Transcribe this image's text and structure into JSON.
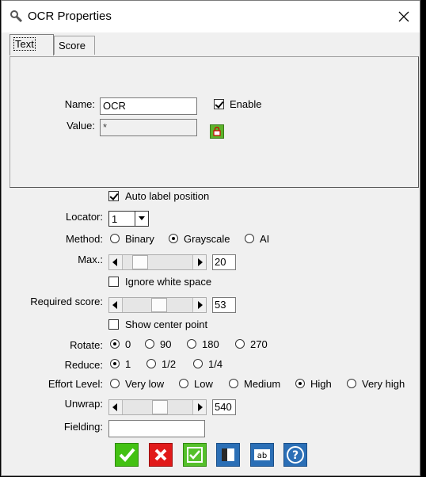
{
  "window": {
    "title": "OCR Properties"
  },
  "tabs": [
    "Text",
    "Score"
  ],
  "panel": {
    "name_label": "Name:",
    "name_value": "OCR",
    "enable_label": "Enable",
    "value_label": "Value:",
    "value_value": "*"
  },
  "auto_label": "Auto label position",
  "locator": {
    "label": "Locator:",
    "value": "1"
  },
  "method": {
    "label": "Method:",
    "options": [
      "Binary",
      "Grayscale",
      "AI"
    ],
    "selected": "Grayscale"
  },
  "max": {
    "label": "Max.:",
    "value": "20",
    "level": 0.17
  },
  "ignore_ws": "Ignore white space",
  "required_score": {
    "label": "Required score:",
    "value": "53",
    "level": 0.53
  },
  "show_center": "Show center point",
  "rotate": {
    "label": "Rotate:",
    "options": [
      "0",
      "90",
      "180",
      "270"
    ],
    "selected": "0"
  },
  "reduce": {
    "label": "Reduce:",
    "options": [
      "1",
      "1/2",
      "1/4"
    ],
    "selected": "1"
  },
  "effort": {
    "label": "Effort Level:",
    "options": [
      "Very low",
      "Low",
      "Medium",
      "High",
      "Very high"
    ],
    "selected": "High"
  },
  "unwrap": {
    "label": "Unwrap:",
    "value": "540",
    "level": 0.54
  },
  "fielding": {
    "label": "Fielding:",
    "value": ""
  },
  "icons": {
    "ok": "checkmark-icon",
    "cancel": "x-icon",
    "apply": "checkbox-icon",
    "view": "panel-icon",
    "text": "ab-icon",
    "help": "question-icon"
  },
  "colors": {
    "ok": "#43c113",
    "cancel": "#e11a1a",
    "apply": "#55c02b",
    "blue": "#2b6fb6"
  }
}
